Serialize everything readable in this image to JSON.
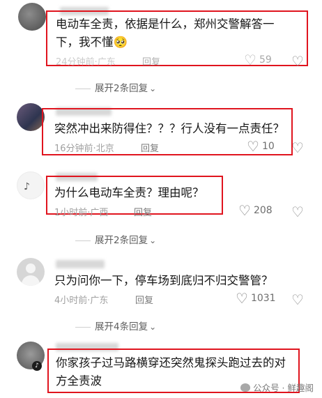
{
  "comments": [
    {
      "text_lines": [
        "电动车全责，依据是什么，郑州交警解答一",
        "下，我不懂🥺"
      ],
      "time": "24分钟前",
      "location": "广东",
      "reply_label": "回复",
      "likes": "59"
    },
    {
      "text_lines": [
        "突然冲出来防得住？？？行人没有一点责任？"
      ],
      "time": "16分钟前",
      "location": "北京",
      "reply_label": "回复",
      "likes": "10"
    },
    {
      "text_lines": [
        "为什么电动车全责？理由呢？"
      ],
      "time": "1小时前",
      "location": "广西",
      "reply_label": "回复",
      "likes": "208"
    },
    {
      "text_lines": [
        "只为问你一下，停车场到底归不归交警管？"
      ],
      "time": "4小时前",
      "location": "广东",
      "reply_label": "回复",
      "likes": "1031"
    },
    {
      "text_lines": [
        "你家孩子过马路横穿还突然鬼探头跑过去的对",
        "方全责波"
      ]
    }
  ],
  "expand_links": [
    "展开2条回复",
    "展开2条回复",
    "展开4条回复"
  ],
  "meta_separator": "·",
  "watermark": "公众号 · 鲜趣阁",
  "icons": {
    "like": "heart-outline-icon",
    "dislike": "broken-heart-icon",
    "expand": "chevron-down-icon"
  },
  "colors": {
    "highlight_box": "#e0141e",
    "meta_text": "#a0a0a0"
  }
}
